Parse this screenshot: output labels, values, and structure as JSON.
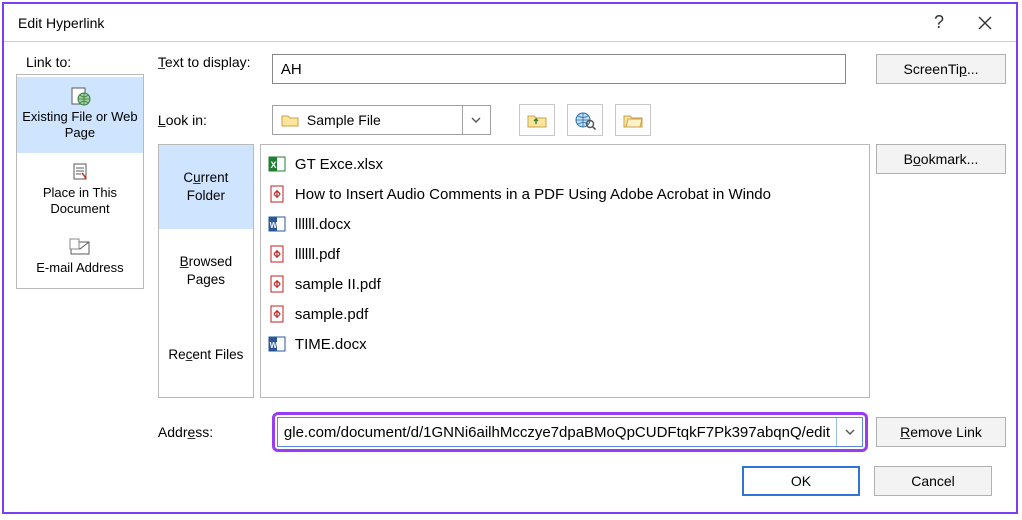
{
  "window": {
    "title": "Edit Hyperlink"
  },
  "linkto": {
    "label": "Link to:",
    "items": [
      {
        "label": "Existing File or Web Page",
        "icon": "globe-page-icon",
        "selected": true
      },
      {
        "label": "Place in This Document",
        "icon": "doc-target-icon",
        "selected": false
      },
      {
        "label": "E-mail Address",
        "icon": "email-icon",
        "selected": false
      }
    ]
  },
  "text_to_display": {
    "label": "Text to display:",
    "value": "AH"
  },
  "screentip_button": "ScreenTip...",
  "lookin": {
    "label": "Look in:",
    "value": "Sample File"
  },
  "toolbar_icons": [
    "up-folder-icon",
    "browse-web-icon",
    "browse-file-icon"
  ],
  "tabs": [
    {
      "label": "Current Folder",
      "selected": true
    },
    {
      "label": "Browsed Pages",
      "selected": false
    },
    {
      "label": "Recent Files",
      "selected": false
    }
  ],
  "files": [
    {
      "name": "GT Exce.xlsx",
      "icon": "excel-icon"
    },
    {
      "name": "How to Insert Audio Comments in a PDF Using Adobe Acrobat in Windo",
      "icon": "pdf-icon"
    },
    {
      "name": "llllll.docx",
      "icon": "word-icon"
    },
    {
      "name": "llllll.pdf",
      "icon": "pdf-icon"
    },
    {
      "name": "sample II.pdf",
      "icon": "pdf-icon"
    },
    {
      "name": "sample.pdf",
      "icon": "pdf-icon"
    },
    {
      "name": "TIME.docx",
      "icon": "word-icon"
    }
  ],
  "bookmark_button": "Bookmark...",
  "address": {
    "label": "Address:",
    "value": "gle.com/document/d/1GNNi6ailhMcczye7dpaBMoQpCUDFtqkF7Pk397abqnQ/edit"
  },
  "remove_link_button": "Remove Link",
  "footer": {
    "ok": "OK",
    "cancel": "Cancel"
  }
}
